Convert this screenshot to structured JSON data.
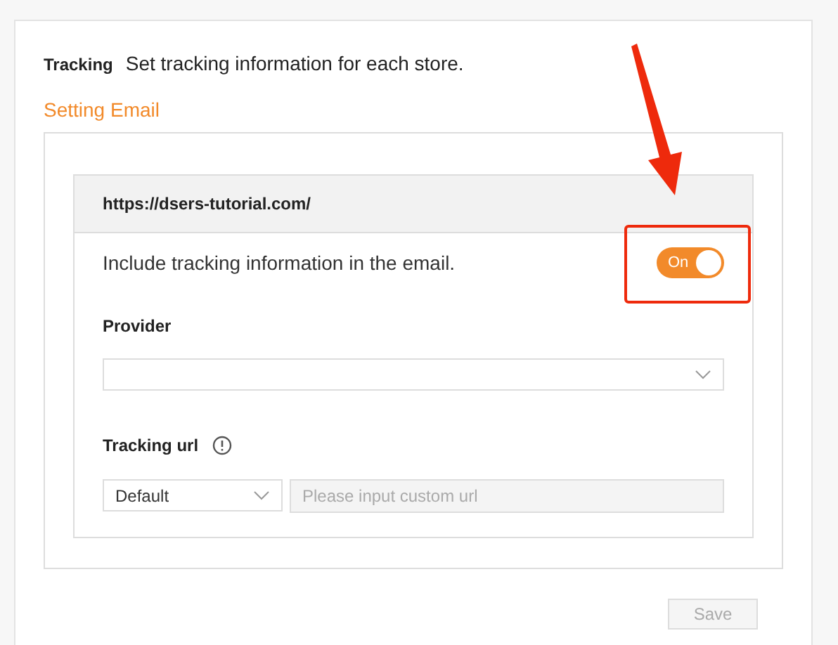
{
  "header": {
    "label": "Tracking",
    "description": "Set tracking information for each store."
  },
  "section_title": "Setting Email",
  "store": {
    "url": "https://dsers-tutorial.com/",
    "toggle": {
      "label": "Include tracking information in the email.",
      "on": true,
      "text": "On"
    },
    "provider": {
      "label": "Provider"
    },
    "tracking_url": {
      "label": "Tracking url",
      "select_value": "Default",
      "input": {
        "placeholder": "Please input custom url",
        "disabled": true
      }
    }
  },
  "save_button": {
    "label": "Save",
    "disabled": true
  }
}
